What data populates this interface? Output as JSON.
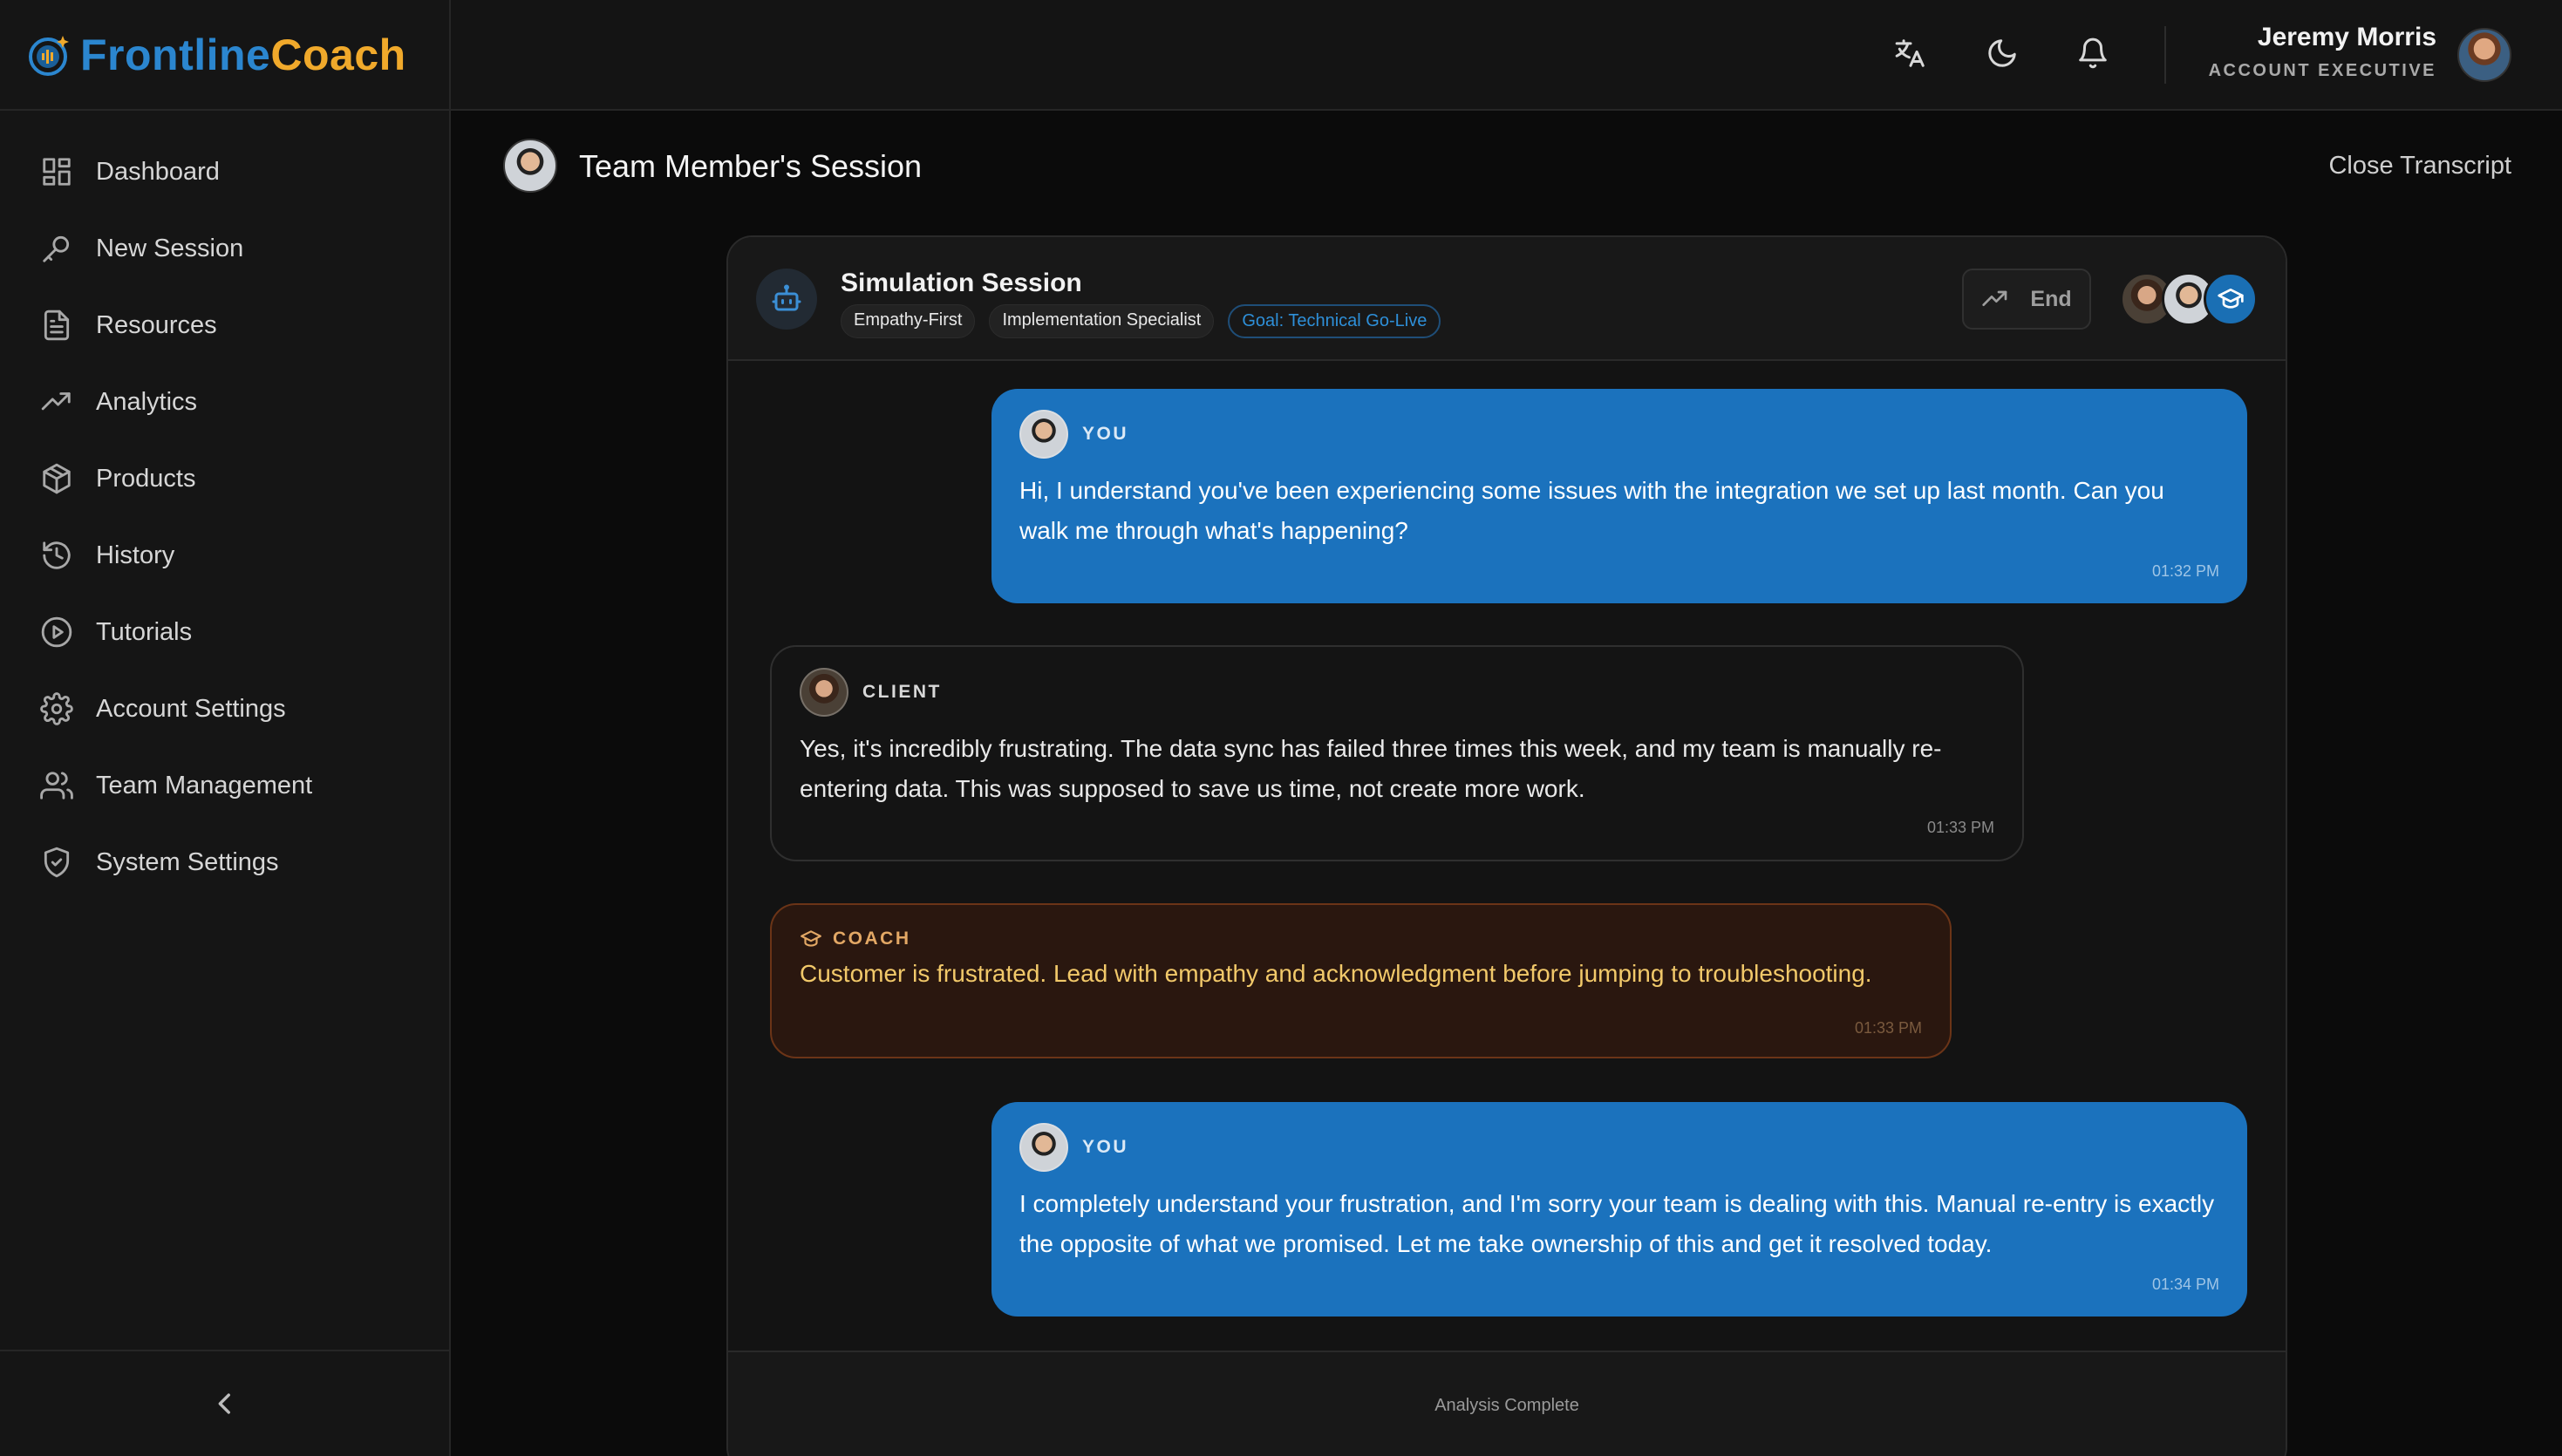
{
  "brand": {
    "part1": "Frontline",
    "part2": "Coach"
  },
  "sidebar": {
    "items": [
      {
        "label": "Dashboard",
        "icon": "dashboard-icon"
      },
      {
        "label": "New Session",
        "icon": "new-session-icon"
      },
      {
        "label": "Resources",
        "icon": "document-icon"
      },
      {
        "label": "Analytics",
        "icon": "trending-up-icon"
      },
      {
        "label": "Products",
        "icon": "package-icon"
      },
      {
        "label": "History",
        "icon": "history-icon"
      },
      {
        "label": "Tutorials",
        "icon": "play-circle-icon"
      },
      {
        "label": "Account Settings",
        "icon": "gear-icon"
      },
      {
        "label": "Team Management",
        "icon": "users-icon"
      },
      {
        "label": "System Settings",
        "icon": "shield-check-icon"
      }
    ],
    "collapse_icon": "chevron-left-icon"
  },
  "topbar": {
    "icons": [
      "translate-icon",
      "moon-icon",
      "bell-icon"
    ],
    "user": {
      "name": "Jeremy Morris",
      "role": "ACCOUNT EXECUTIVE"
    }
  },
  "page": {
    "title": "Team Member's Session",
    "close_label": "Close Transcript"
  },
  "session": {
    "title": "Simulation Session",
    "tags": [
      "Empathy-First",
      "Implementation Specialist",
      "Goal: Technical Go-Live"
    ],
    "end_label": "End",
    "messages": [
      {
        "role": "you",
        "speaker": "YOU",
        "text": "Hi, I understand you've been experiencing some issues with the integration we set up last month. Can you walk me through what's happening?",
        "time": "01:32 PM"
      },
      {
        "role": "client",
        "speaker": "CLIENT",
        "text": "Yes, it's incredibly frustrating. The data sync has failed three times this week, and my team is manually re-entering data. This was supposed to save us time, not create more work.",
        "time": "01:33 PM"
      },
      {
        "role": "coach",
        "speaker": "COACH",
        "text": "Customer is frustrated. Lead with empathy and acknowledgment before jumping to troubleshooting.",
        "time": "01:33 PM"
      },
      {
        "role": "you",
        "speaker": "YOU",
        "text": "I completely understand your frustration, and I'm sorry your team is dealing with this. Manual re-entry is exactly the opposite of what we promised. Let me take ownership of this and get it resolved today.",
        "time": "01:34 PM"
      }
    ],
    "footer_status": "Analysis Complete"
  },
  "colors": {
    "accent_blue": "#1b72bd",
    "brand_blue": "#2b86cf",
    "brand_orange": "#f0a92b",
    "coach_text": "#f2c96a"
  }
}
